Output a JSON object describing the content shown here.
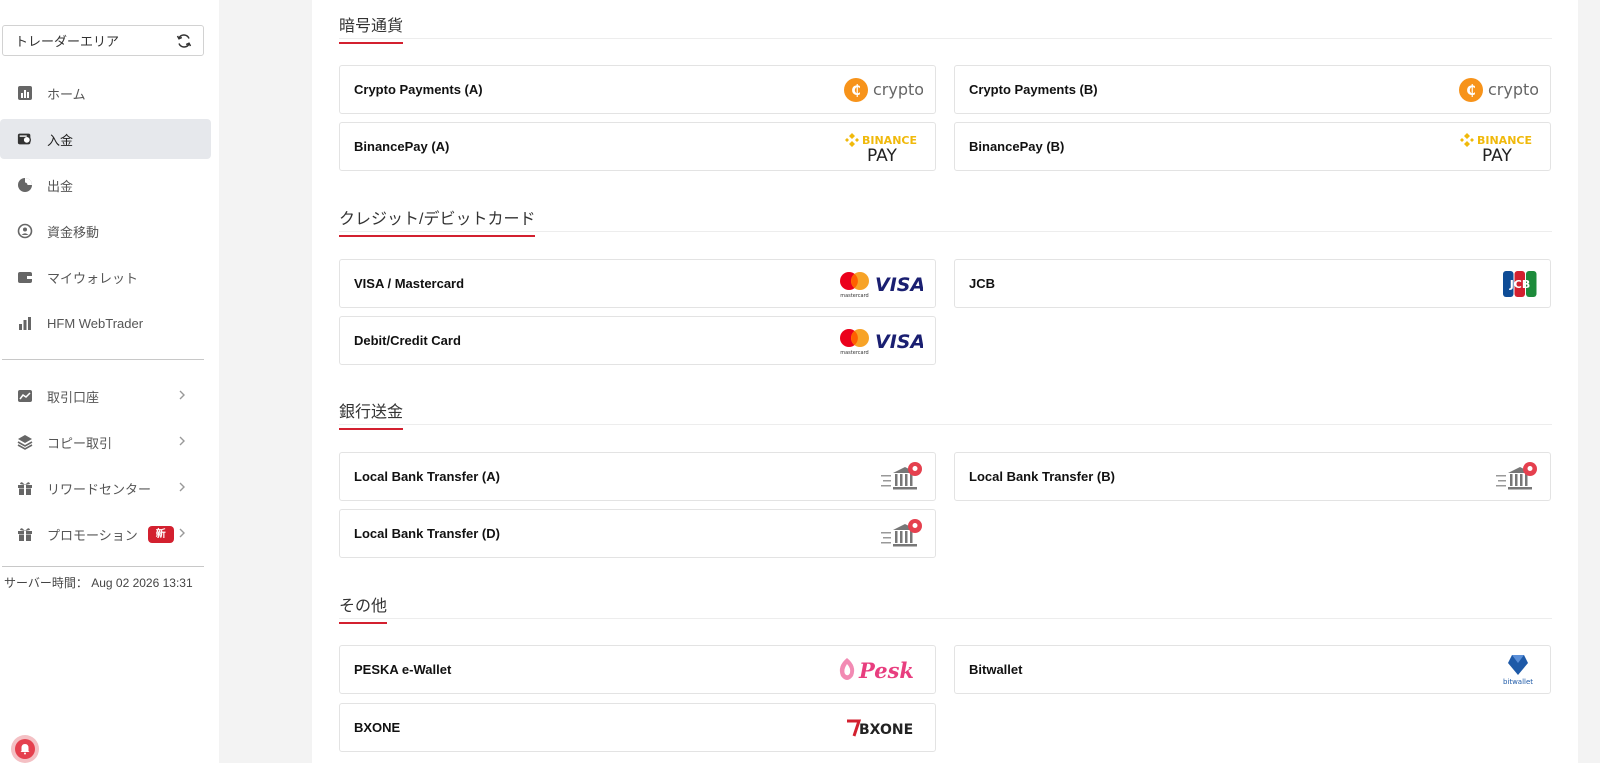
{
  "sidebar": {
    "area_select": "トレーダーエリア",
    "nav": [
      {
        "label": "ホーム",
        "icon": "chart-bar-icon"
      },
      {
        "label": "入金",
        "icon": "wallet-deposit-icon",
        "active": true
      },
      {
        "label": "出金",
        "icon": "withdraw-icon"
      },
      {
        "label": "資金移動",
        "icon": "transfer-icon"
      },
      {
        "label": "マイウォレット",
        "icon": "wallet-icon"
      },
      {
        "label": "HFM WebTrader",
        "icon": "bars-icon"
      }
    ],
    "nav2": [
      {
        "label": "取引口座",
        "icon": "trading-account-icon"
      },
      {
        "label": "コピー取引",
        "icon": "layers-icon"
      },
      {
        "label": "リワードセンター",
        "icon": "gift-icon"
      },
      {
        "label": "プロモーション",
        "icon": "gift-icon",
        "badge": "新"
      }
    ],
    "server_time": "サーバー時間： Aug 02 2026 13:31"
  },
  "sections": [
    {
      "title": "暗号通貨"
    },
    {
      "title": "クレジット/デビットカード"
    },
    {
      "title": "銀行送金"
    },
    {
      "title": "その他"
    }
  ],
  "methods": {
    "crypto_a": "Crypto Payments (A)",
    "crypto_b": "Crypto Payments (B)",
    "binance_a": "BinancePay (A)",
    "binance_b": "BinancePay (B)",
    "visa_mc": "VISA / Mastercard",
    "jcb": "JCB",
    "debit_credit": "Debit/Credit Card",
    "bank_a": "Local Bank Transfer (A)",
    "bank_b": "Local Bank Transfer (B)",
    "bank_d": "Local Bank Transfer (D)",
    "peska": "PESKA e-Wallet",
    "bitwallet": "Bitwallet",
    "bxone": "BXONE"
  },
  "logos": {
    "crypto": "crypto",
    "binance_top": "BINANCE",
    "binance_bottom": "PAY",
    "visa": "VISA",
    "mastercard": "mastercard",
    "jcb": "JCB",
    "peska": "Pesk",
    "bitwallet": "bitwallet",
    "bxone": "BXONE"
  },
  "colors": {
    "accent": "#d3202f",
    "crypto_orange": "#f7931a",
    "binance_yellow": "#f0b90b",
    "visa_blue": "#1a1f71"
  }
}
